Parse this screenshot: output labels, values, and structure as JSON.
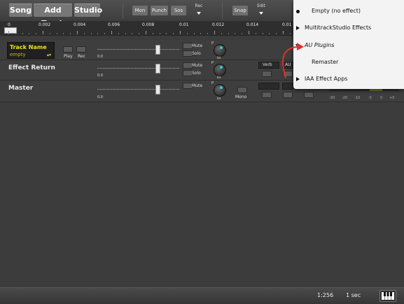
{
  "toolbar": {
    "song": "Song",
    "add_track": "Add Track",
    "studio": "Studio",
    "mon": "Mon",
    "punch": "Punch",
    "sos": "Sos",
    "rec": "Rec",
    "snap": "Snap",
    "edit": "Edit"
  },
  "ruler": {
    "labels": [
      "0",
      "0.002",
      "0.004",
      "0.006",
      "0.008",
      "0.01",
      "0.012",
      "0.014",
      "0.01"
    ]
  },
  "tracks": [
    {
      "name": "Track Name",
      "input": "empty",
      "play": "Play",
      "rec": "Rec",
      "mute": "Mute",
      "solo": "Solo",
      "fader_zero": "0.0",
      "pan_label": "P",
      "pan_value": "64"
    },
    {
      "name": "Effect Return",
      "mute": "Mute",
      "solo": "Solo",
      "fader_zero": "0.0",
      "pan_label": "P",
      "pan_value": "64",
      "effect_slot": "Verb",
      "effect_slot2": "AU"
    },
    {
      "name": "Master",
      "mute": "Mute",
      "mono": "Mono",
      "fader_zero": "0.0",
      "pan_label": "P",
      "pan_value": "64"
    }
  ],
  "meter_scale": [
    "-30",
    "-20",
    "-10",
    "-5",
    "0",
    "+5"
  ],
  "menu": {
    "items": [
      {
        "label": "Empty (no effect)",
        "marker": "bullet"
      },
      {
        "label": "MultitrackStudio Effects",
        "marker": "arrow-right"
      },
      {
        "label": "AU Plugins",
        "marker": "arrow-down"
      },
      {
        "label": "Remaster",
        "marker": "none"
      },
      {
        "label": "IAA Effect Apps",
        "marker": "arrow-right"
      }
    ]
  },
  "status": {
    "zoom": "1:256",
    "time_unit": "1 sec"
  },
  "colors": {
    "track_name_highlight": "#f0e020",
    "knob_indicator": "#27d0e0",
    "annotation_arrow": "#e0302a"
  }
}
